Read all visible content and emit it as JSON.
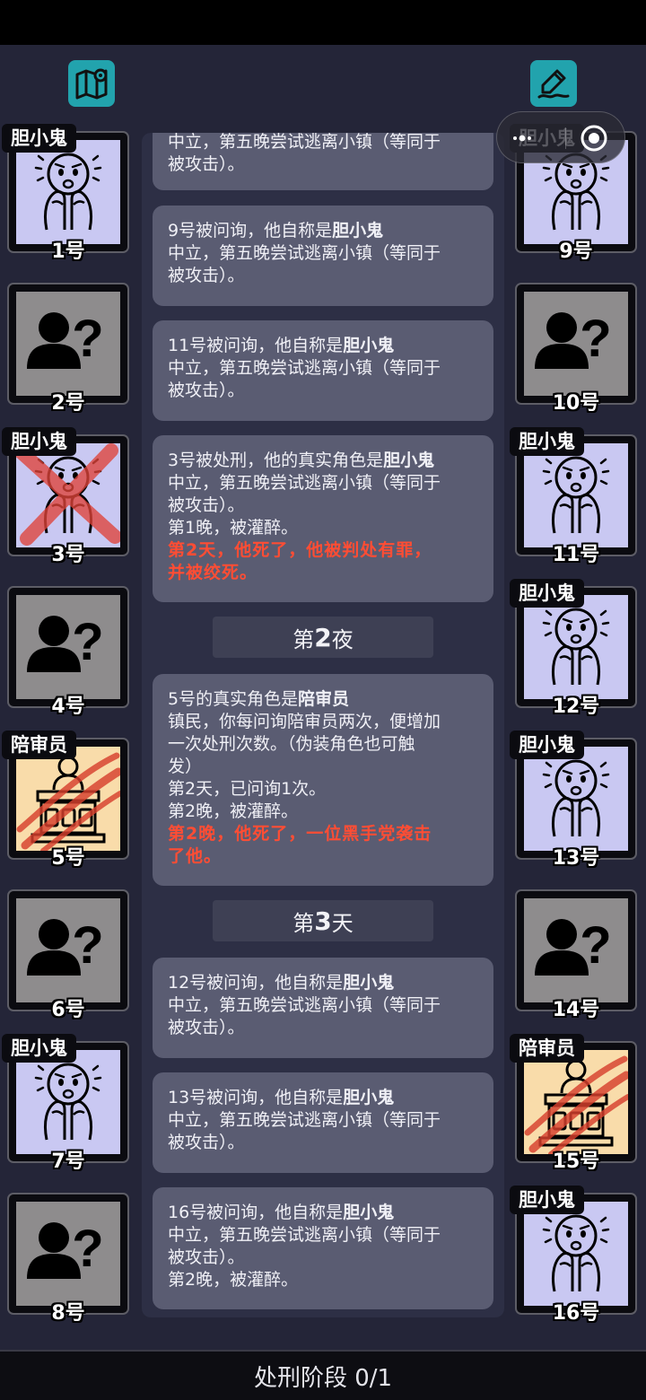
{
  "top_icons": {
    "left": "map-icon",
    "right": "edit-icon"
  },
  "players": [
    {
      "number": "1号",
      "role": "胆小鬼",
      "portrait": "coward"
    },
    {
      "number": "2号",
      "role": "",
      "portrait": "unknown"
    },
    {
      "number": "3号",
      "role": "胆小鬼",
      "portrait": "coward",
      "status": "executed"
    },
    {
      "number": "4号",
      "role": "",
      "portrait": "unknown"
    },
    {
      "number": "5号",
      "role": "陪审员",
      "portrait": "juror",
      "status": "attacked"
    },
    {
      "number": "6号",
      "role": "",
      "portrait": "unknown"
    },
    {
      "number": "7号",
      "role": "胆小鬼",
      "portrait": "coward"
    },
    {
      "number": "8号",
      "role": "",
      "portrait": "unknown"
    },
    {
      "number": "9号",
      "role": "胆小鬼",
      "portrait": "coward"
    },
    {
      "number": "10号",
      "role": "",
      "portrait": "unknown"
    },
    {
      "number": "11号",
      "role": "胆小鬼",
      "portrait": "coward"
    },
    {
      "number": "12号",
      "role": "胆小鬼",
      "portrait": "coward"
    },
    {
      "number": "13号",
      "role": "胆小鬼",
      "portrait": "coward"
    },
    {
      "number": "14号",
      "role": "",
      "portrait": "unknown"
    },
    {
      "number": "15号",
      "role": "陪审员",
      "portrait": "juror",
      "status": "attacked"
    },
    {
      "number": "16号",
      "role": "胆小鬼",
      "portrait": "coward"
    }
  ],
  "log": {
    "card0": {
      "l1": "中立，第五晚尝试逃离小镇（等同于",
      "l2": "被攻击）。"
    },
    "card1": {
      "l0a": "9号被问询，他自称是",
      "l0b": "胆小鬼",
      "l1": "中立，第五晚尝试逃离小镇（等同于",
      "l2": "被攻击）。"
    },
    "card2": {
      "l0a": "11号被问询，他自称是",
      "l0b": "胆小鬼",
      "l1": "中立，第五晚尝试逃离小镇（等同于",
      "l2": "被攻击）。"
    },
    "card3": {
      "l0a": "3号被处刑，他的真实角色是",
      "l0b": "胆小鬼",
      "l1": "中立，第五晚尝试逃离小镇（等同于",
      "l2": "被攻击）。",
      "l3": "第1晚，被灌醉。",
      "l4": "第2天，他死了，他被判处有罪，",
      "l5": "并被绞死。"
    },
    "phase1": {
      "a": "第",
      "b": "2",
      "c": "夜"
    },
    "card4": {
      "l0a": "5号的真实角色是",
      "l0b": "陪审员",
      "l1": "镇民，你每问询陪审员两次，便增加",
      "l2": "一次处刑次数。（伪装角色也可触",
      "l3": "发）",
      "l4": "第2天，已问询1次。",
      "l5": "第2晚，被灌醉。",
      "l6": "第2晚，他死了，一位黑手党袭击",
      "l7": "了他。"
    },
    "phase2": {
      "a": "第",
      "b": "3",
      "c": "天"
    },
    "card5": {
      "l0a": "12号被问询，他自称是",
      "l0b": "胆小鬼",
      "l1": "中立，第五晚尝试逃离小镇（等同于",
      "l2": "被攻击）。"
    },
    "card6": {
      "l0a": "13号被问询，他自称是",
      "l0b": "胆小鬼",
      "l1": "中立，第五晚尝试逃离小镇（等同于",
      "l2": "被攻击）。"
    },
    "card7": {
      "l0a": "16号被问询，他自称是",
      "l0b": "胆小鬼",
      "l1": "中立，第五晚尝试逃离小镇（等同于",
      "l2": "被攻击）。",
      "l3": "第2晚，被灌醉。"
    }
  },
  "bottom_bar": {
    "label": "处刑阶段 0/1"
  },
  "colors": {
    "background": "#242538",
    "card": "#5a5c72",
    "death_text": "#ff4d34",
    "accent": "#22a3ad"
  }
}
